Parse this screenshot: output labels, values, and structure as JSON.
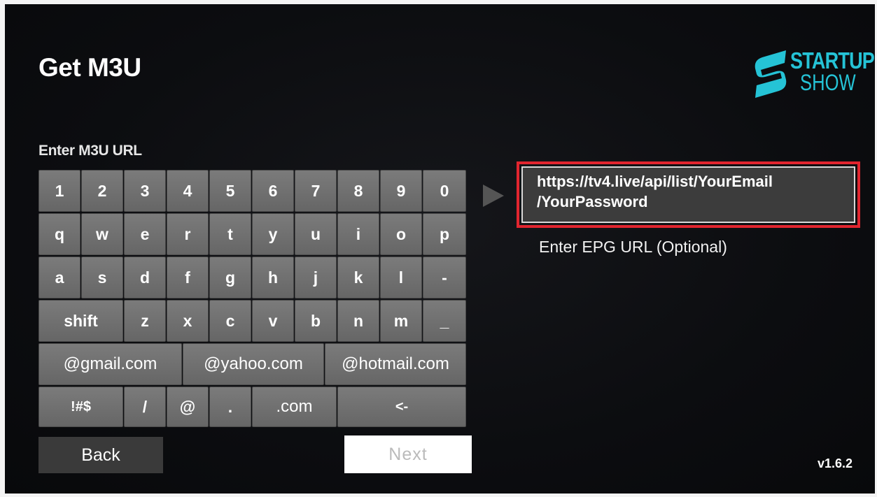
{
  "screen": {
    "title": "Get M3U",
    "brand": {
      "line1": "STARTUP",
      "line2": "SHOW",
      "color": "#25c3d6"
    },
    "field_label": "Enter M3U URL",
    "keyboard": {
      "row1": [
        "1",
        "2",
        "3",
        "4",
        "5",
        "6",
        "7",
        "8",
        "9",
        "0"
      ],
      "row2": [
        "q",
        "w",
        "e",
        "r",
        "t",
        "y",
        "u",
        "i",
        "o",
        "p"
      ],
      "row3": [
        "a",
        "s",
        "d",
        "f",
        "g",
        "h",
        "j",
        "k",
        "l",
        "-"
      ],
      "row4": [
        "shift",
        "z",
        "x",
        "c",
        "v",
        "b",
        "n",
        "m",
        "_"
      ],
      "row5": [
        "@gmail.com",
        "@yahoo.com",
        "@hotmail.com"
      ],
      "row6": [
        "!#$",
        "/",
        "@",
        ".",
        ".com",
        "<-"
      ]
    },
    "url_input": {
      "value_line1": "https://tv4.live/api/list/YourEmail",
      "value_line2": "/YourPassword",
      "highlight_color": "#e1252f"
    },
    "epg_label": "Enter EPG URL (Optional)",
    "back_button": "Back",
    "next_button": "Next",
    "version": "v1.6.2"
  }
}
